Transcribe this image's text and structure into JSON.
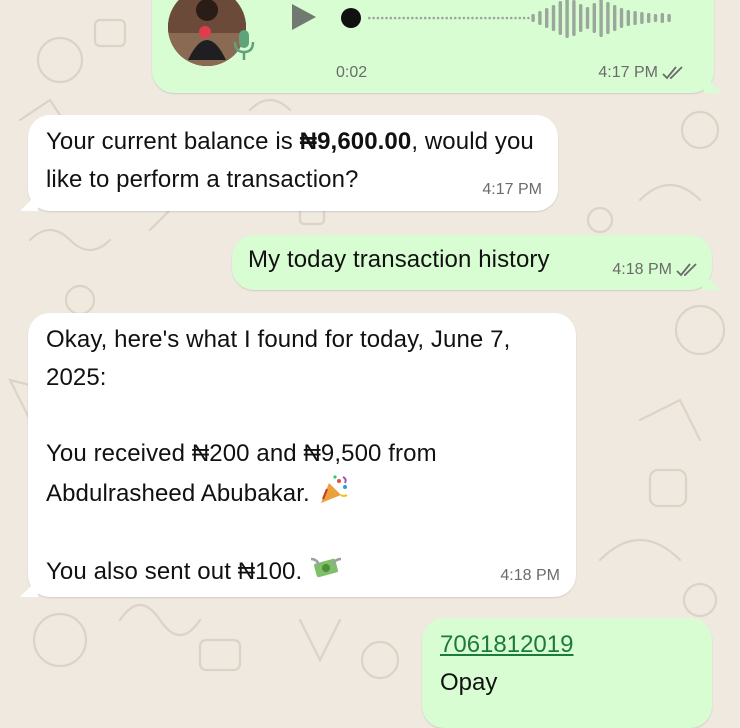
{
  "voice_message": {
    "duration": "0:02",
    "time": "4:17 PM",
    "status": "read",
    "play_icon": "play-icon",
    "mic_icon": "mic-icon"
  },
  "messages": [
    {
      "direction": "incoming",
      "text_before": "Your current balance is ",
      "text_bold": "₦9,600.00",
      "text_after": ", would you like to perform a transaction?",
      "time": "4:17 PM"
    },
    {
      "direction": "outgoing",
      "text": "My today transaction history",
      "time": "4:18 PM",
      "status": "read"
    },
    {
      "direction": "incoming",
      "para1": "Okay, here's what I found for today, June 7, 2025:",
      "para2": "You received ₦200 and ₦9,500 from Abdulrasheed Abubakar.",
      "para2_emoji": "party-popper",
      "para3": "You also sent out ₦100.",
      "para3_emoji": "money-with-wings",
      "time": "4:18 PM"
    },
    {
      "direction": "outgoing",
      "link": "7061812019",
      "line2": "Opay"
    }
  ],
  "colors": {
    "wallpaper": "#efe9e0",
    "outgoing_bubble": "#d9fdd3",
    "incoming_bubble": "#ffffff",
    "link": "#1d7a3f"
  }
}
